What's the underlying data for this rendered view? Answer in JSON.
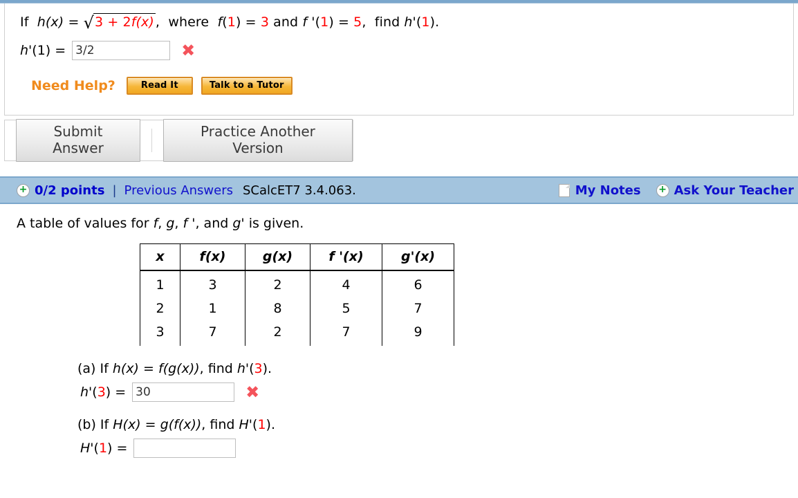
{
  "question1": {
    "prompt": {
      "lead": "If",
      "h_of_x": "h(x)",
      "equals": "=",
      "radicand_a": "3",
      "radicand_plus": "+",
      "radicand_b": "2",
      "radicand_fx": "f(x)",
      "after_radical": ",",
      "where": "where",
      "f1": "f",
      "f1_arg": "1",
      "f1_value": "3",
      "and": "and",
      "fprime": "f '",
      "fprime_arg": "1",
      "fprime_value": "5",
      "comma": ",",
      "find": "find",
      "target": "h'",
      "target_arg": "1",
      "period": ")."
    },
    "answer": {
      "label_fn": "h'",
      "label_arg": "1",
      "label_eq": ") =",
      "value": "3/2",
      "placeholder": "",
      "status_icon": "x-mark-incorrect"
    },
    "need_help": {
      "label": "Need Help?",
      "read_it": "Read It",
      "talk_to_tutor": "Talk to a Tutor"
    }
  },
  "actions": {
    "submit_answer": "Submit Answer",
    "practice_another_version": "Practice Another Version"
  },
  "question2": {
    "header": {
      "points": "0/2 points",
      "separator": "|",
      "previous_answers": "Previous Answers",
      "question_code": "SCalcET7 3.4.063.",
      "my_notes": "My Notes",
      "ask_your_teacher": "Ask Your Teacher",
      "bar_color": "#a3c4de",
      "link_color": "#1111cc"
    },
    "intro_parts": {
      "a": "A table of values for",
      "f": "f",
      "c1": ",",
      "g": "g",
      "c2": ",",
      "fprime": "f '",
      "c3": ", and",
      "gprime": "g'",
      "tail": "is given."
    },
    "table": {
      "headers": [
        "x",
        "f(x)",
        "g(x)",
        "f '(x)",
        "g'(x)"
      ],
      "rows": [
        [
          "1",
          "3",
          "2",
          "4",
          "6"
        ],
        [
          "2",
          "1",
          "8",
          "5",
          "7"
        ],
        [
          "3",
          "7",
          "2",
          "7",
          "9"
        ]
      ]
    },
    "part_a": {
      "label": "(a) If",
      "fn": "h(x)",
      "eq": "=",
      "composition": "f(g(x))",
      "comma_find": ", find",
      "target_fn": "h'",
      "target_arg": "3",
      "target_tail": ").",
      "answer_fn": "h'",
      "answer_arg": "3",
      "answer_eq": ") =",
      "value": "30",
      "status_icon": "x-mark-incorrect"
    },
    "part_b": {
      "label": "(b) If",
      "fn": "H(x)",
      "eq": "=",
      "composition": "g(f(x))",
      "comma_find": ", find",
      "target_fn": "H'",
      "target_arg": "1",
      "target_tail": ").",
      "answer_fn": "H'",
      "answer_arg": "1",
      "answer_eq": ") =",
      "value": "",
      "status_icon": "none"
    }
  }
}
